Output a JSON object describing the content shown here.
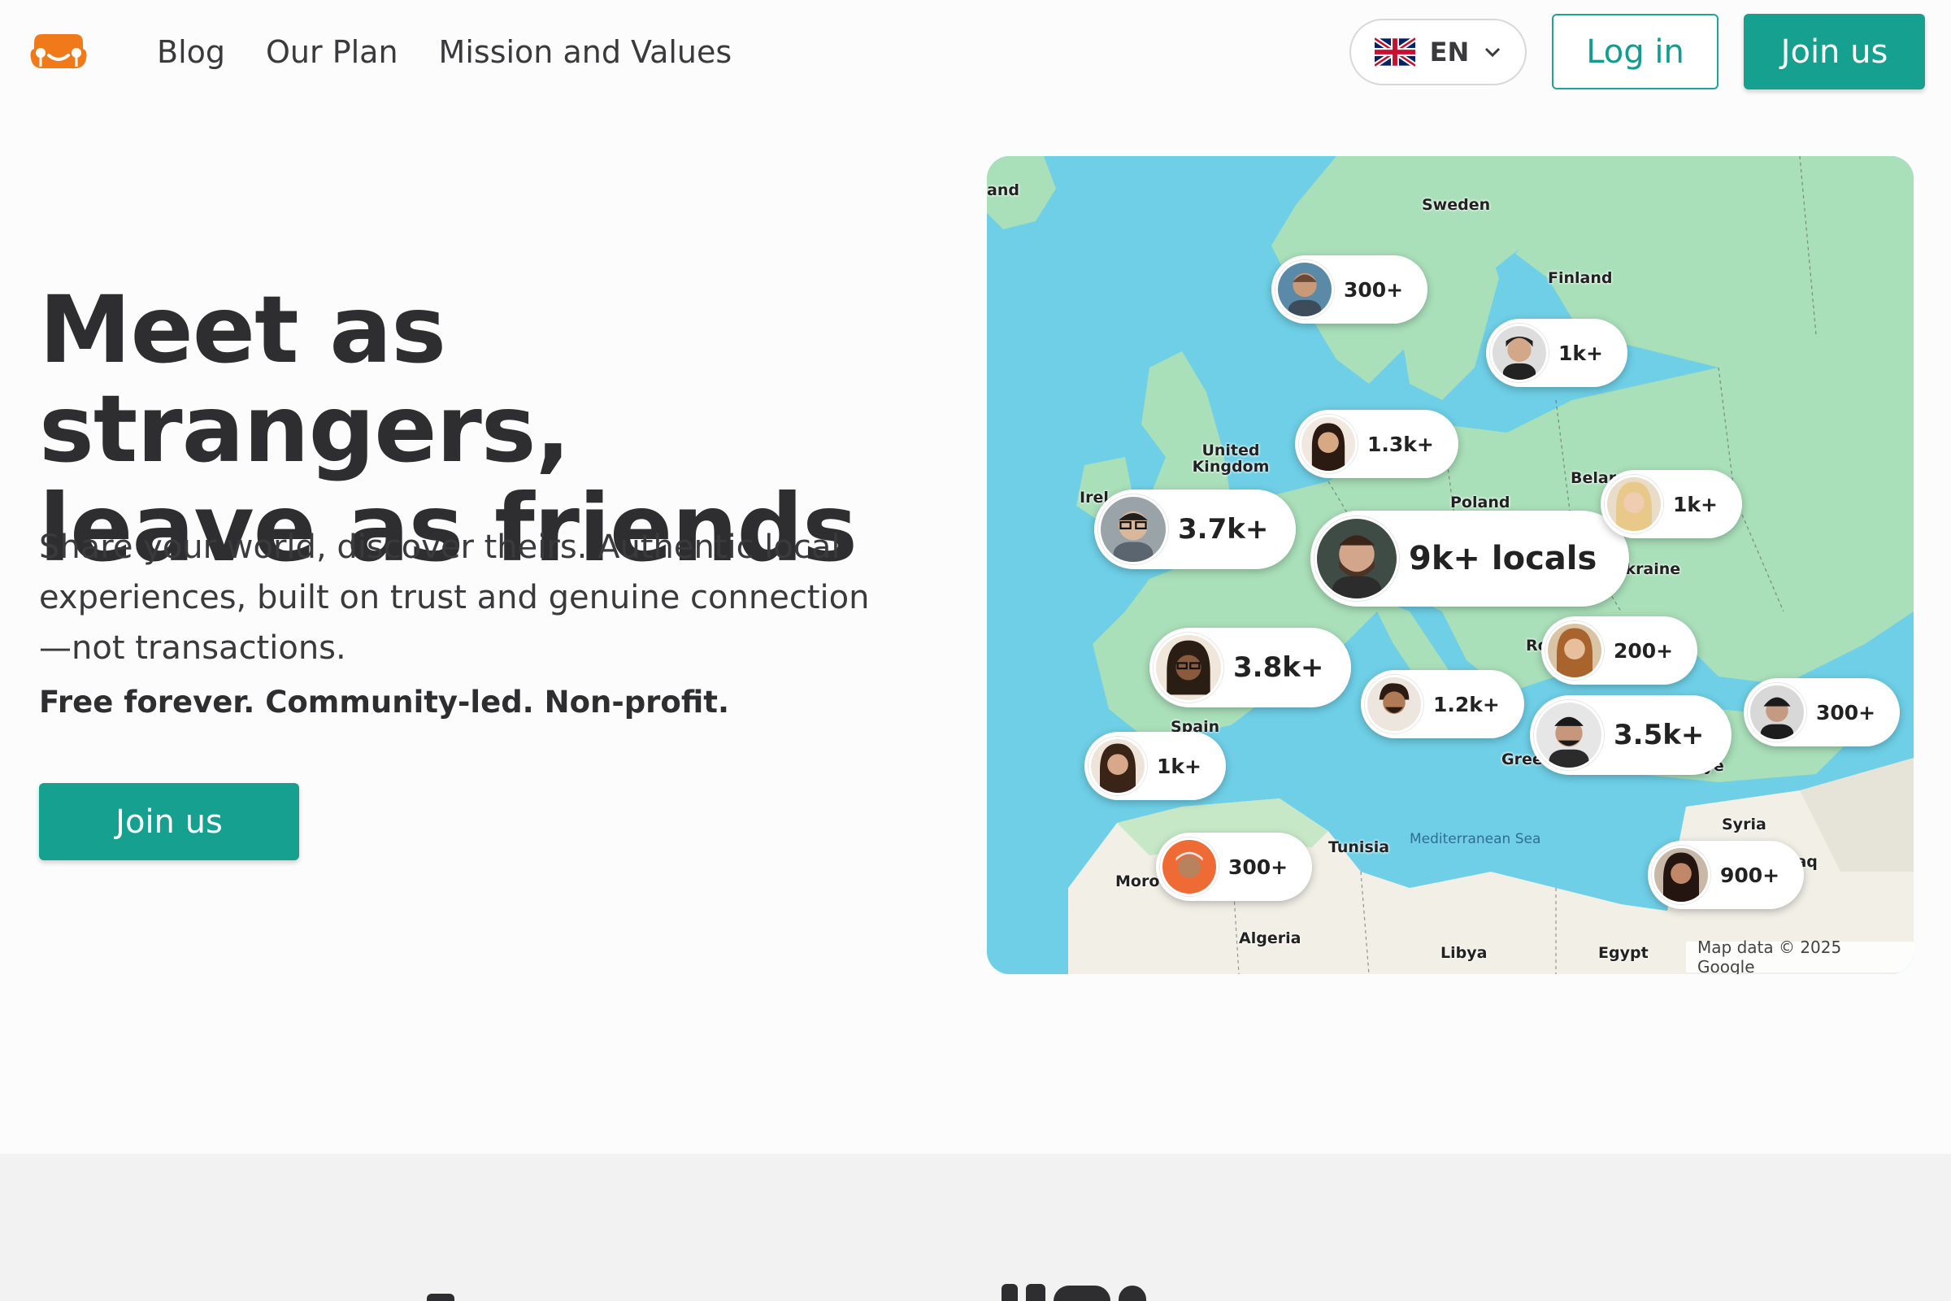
{
  "header": {
    "nav": [
      {
        "label": "Blog"
      },
      {
        "label": "Our Plan"
      },
      {
        "label": "Mission and Values"
      }
    ],
    "language": {
      "code": "EN",
      "flag": "uk-flag-icon"
    },
    "login_label": "Log in",
    "join_label": "Join us"
  },
  "hero": {
    "title_line1": "Meet as strangers,",
    "title_line2": "leave as friends",
    "subtitle": "Share your world, discover theirs. Authentic local experiences, built on trust and genuine connection—not transactions.",
    "tagline": "Free forever. Community-led. Non-profit.",
    "cta_label": "Join us"
  },
  "map": {
    "countries": [
      {
        "label": "Sweden"
      },
      {
        "label": "Finland"
      },
      {
        "label": "United Kingdom"
      },
      {
        "label": "Poland"
      },
      {
        "label": "Belar"
      },
      {
        "label": "Ukraine"
      },
      {
        "label": "Spain"
      },
      {
        "label": "Ro"
      },
      {
        "label": "Gree"
      },
      {
        "label": "rkiye"
      },
      {
        "label": "Syria"
      },
      {
        "label": "Iraq"
      },
      {
        "label": "Tunisia"
      },
      {
        "label": "Moro"
      },
      {
        "label": "Algeria"
      },
      {
        "label": "Libya"
      },
      {
        "label": "Egypt"
      },
      {
        "label": "Irel"
      },
      {
        "label": "and"
      }
    ],
    "sea_label": "Mediterranean Sea",
    "credit": "Map data © 2025 Google",
    "pins": [
      {
        "count": "300+"
      },
      {
        "count": "1k+"
      },
      {
        "count": "1.3k+"
      },
      {
        "count": "3.7k+"
      },
      {
        "count": "9k+ locals"
      },
      {
        "count": "1k+"
      },
      {
        "count": "3.8k+"
      },
      {
        "count": "200+"
      },
      {
        "count": "1.2k+"
      },
      {
        "count": "3.5k+"
      },
      {
        "count": "300+"
      },
      {
        "count": "1k+"
      },
      {
        "count": "300+"
      },
      {
        "count": "900+"
      }
    ]
  },
  "colors": {
    "brand": "#15a08f",
    "logo": "#f07a1a",
    "sea": "#6ecfe6",
    "land": "#a9dfb9",
    "desert": "#f1efe6"
  }
}
